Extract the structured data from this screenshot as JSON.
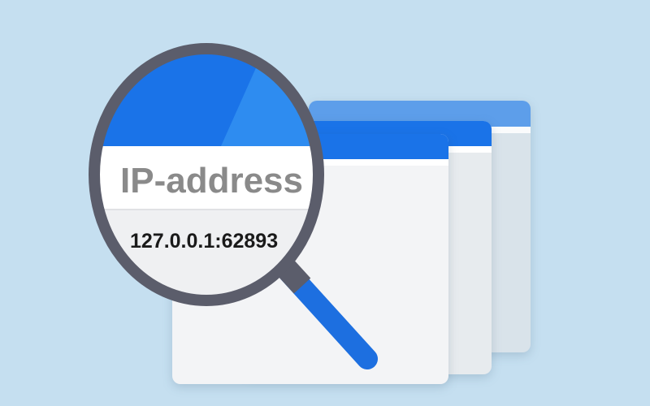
{
  "illustration": {
    "label": "IP-address",
    "value": "127.0.0.1:62893"
  },
  "colors": {
    "background": "#c5dff0",
    "window_title_blue": "#1a73e8",
    "window_title_light": "#5d9eea",
    "window_body": "#f3f4f6",
    "magnifier_rim": "#5b5d6b",
    "handle": "#1d6fe0"
  },
  "icons": [
    "magnifying-glass-icon",
    "browser-window-icon"
  ]
}
